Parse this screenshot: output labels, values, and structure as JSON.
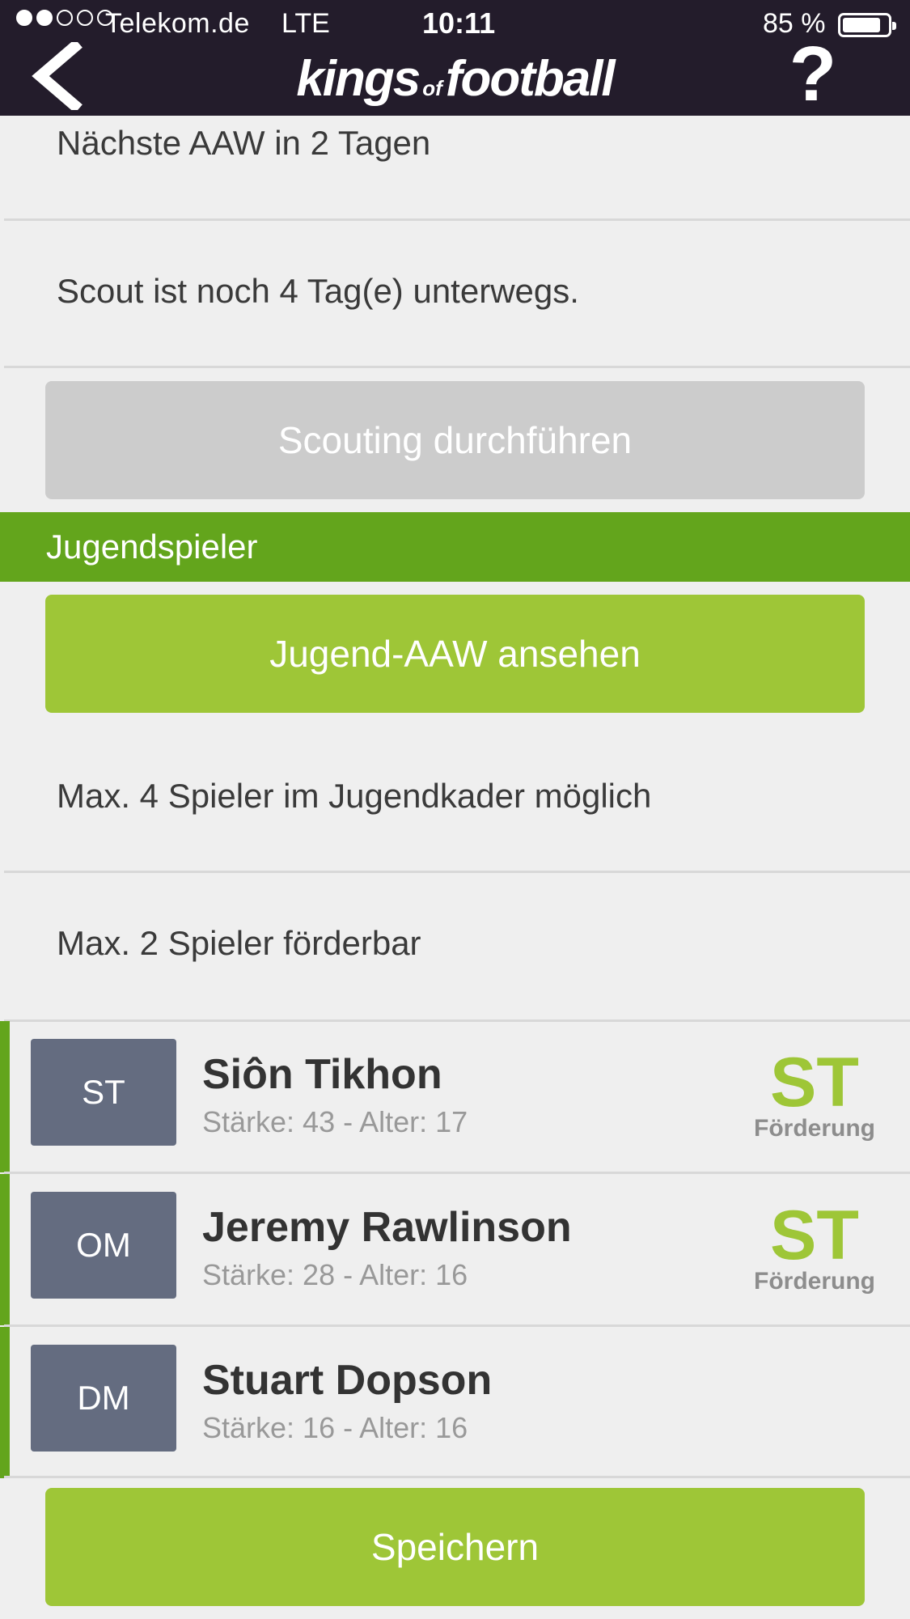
{
  "status_bar": {
    "carrier": "Telekom.de",
    "network": "LTE",
    "time": "10:11",
    "battery_percent": "85 %",
    "battery_level": 0.85,
    "signal_bars_filled": 2,
    "signal_bars_total": 5
  },
  "nav": {
    "logo_main_1": "kings",
    "logo_of": "of",
    "logo_main_2": "football",
    "help_label": "?"
  },
  "scouting": {
    "next_aaw": "Nächste AAW in 2 Tagen",
    "scout_status": "Scout ist noch 4 Tag(e) unterwegs.",
    "button_label": "Scouting durchführen"
  },
  "youth": {
    "section_title": "Jugendspieler",
    "view_button_label": "Jugend-AAW ansehen",
    "max_players_info": "Max. 4 Spieler im Jugendkader möglich",
    "max_promotable_info": "Max. 2 Spieler förderbar",
    "players": [
      {
        "position": "ST",
        "name": "Siôn Tikhon",
        "stats": "Stärke: 43 - Alter: 17",
        "promo_position": "ST",
        "promo_label": "Förderung"
      },
      {
        "position": "OM",
        "name": "Jeremy Rawlinson",
        "stats": "Stärke: 28 - Alter: 16",
        "promo_position": "ST",
        "promo_label": "Förderung"
      },
      {
        "position": "DM",
        "name": "Stuart Dopson",
        "stats": "Stärke: 16 - Alter: 16",
        "promo_position": "",
        "promo_label": ""
      }
    ],
    "save_button_label": "Speichern"
  },
  "colors": {
    "header_bg": "#231c2b",
    "section_green": "#63a51c",
    "button_green": "#9ec637",
    "button_gray": "#cccccc",
    "badge_bg": "#646c80",
    "page_bg": "#efefef"
  }
}
